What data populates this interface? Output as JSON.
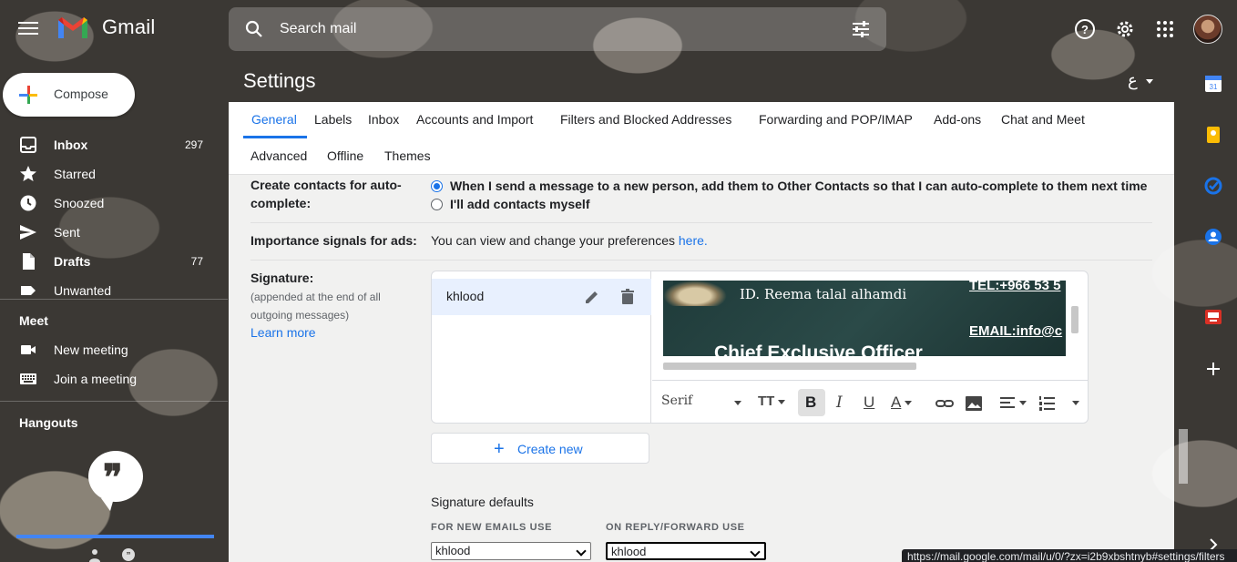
{
  "app": {
    "title": "Gmail"
  },
  "search": {
    "placeholder": "Search mail"
  },
  "compose": {
    "label": "Compose"
  },
  "nav": {
    "items": [
      {
        "label": "Inbox",
        "count": "297",
        "bold": true
      },
      {
        "label": "Starred",
        "count": ""
      },
      {
        "label": "Snoozed",
        "count": ""
      },
      {
        "label": "Sent",
        "count": ""
      },
      {
        "label": "Drafts",
        "count": "77",
        "bold": true
      },
      {
        "label": "Unwanted",
        "count": ""
      }
    ],
    "meet": {
      "title": "Meet",
      "new_meeting": "New meeting",
      "join": "Join a meeting"
    },
    "hangouts": {
      "title": "Hangouts"
    }
  },
  "settings": {
    "title": "Settings",
    "lang": "ع",
    "tabs": [
      "General",
      "Labels",
      "Inbox",
      "Accounts and Import",
      "Filters and Blocked Addresses",
      "Forwarding and POP/IMAP",
      "Add-ons",
      "Chat and Meet",
      "Advanced",
      "Offline",
      "Themes"
    ],
    "autocomplete": {
      "label": "Create contacts for auto-complete:",
      "option1": "When I send a message to a new person, add them to Other Contacts so that I can auto-complete to them next time",
      "option2": "I'll add contacts myself"
    },
    "ads": {
      "label": "Importance signals for ads:",
      "text": "You can view and change your preferences",
      "link": "here."
    },
    "signature": {
      "label": "Signature:",
      "note": "(appended at the end of all outgoing messages)",
      "learn_more": "Learn more",
      "name": "khlood",
      "image_lines": {
        "id": "ID. Reema talal alhamdi",
        "tel": "TEL:+966 53 5",
        "email": "EMAIL:info@c",
        "title": "Chief Exclusive Officer"
      },
      "font": "Serif",
      "create_new": "Create new",
      "defaults_title": "Signature defaults",
      "new_emails_label": "FOR NEW EMAILS USE",
      "reply_label": "ON REPLY/FORWARD USE",
      "new_emails_value": "khlood",
      "reply_value": "khlood"
    }
  },
  "status_bar": {
    "url": "https://mail.google.com/mail/u/0/?zx=i2b9xbshtnyb#settings/filters"
  },
  "colors": {
    "accent": "#1a73e8",
    "selected_bg": "#e8f0fe"
  }
}
